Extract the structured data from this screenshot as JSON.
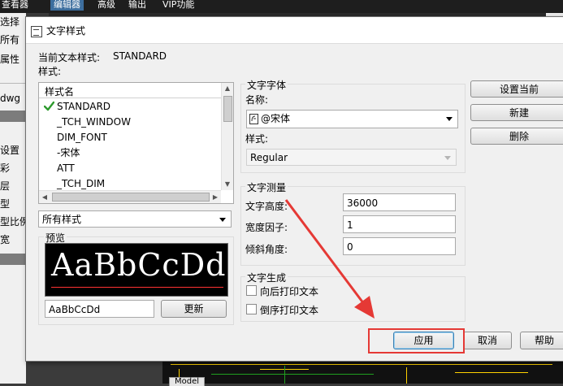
{
  "app": {
    "menu": [
      "查看器",
      "编辑器",
      "高级",
      "输出",
      "VIP功能"
    ],
    "left_panel_rows": [
      "选择",
      "所有",
      "属性",
      "dwg",
      "设置",
      "彩",
      "层",
      "型",
      "型比例",
      "宽"
    ],
    "model_tab": "Model"
  },
  "dialog": {
    "title": "文字样式",
    "current_style_label": "当前文本样式:",
    "current_style_value": "STANDARD",
    "styles_label": "样式:",
    "style_list": {
      "header": "样式名",
      "items": [
        "STANDARD",
        "_TCH_WINDOW",
        "DIM_FONT",
        "-宋体",
        "ATT",
        "_TCH_DIM"
      ],
      "checked_index": 0
    },
    "filter_select": {
      "value": "所有样式"
    },
    "preview": {
      "label": "预览",
      "sample": "AaBbCcDd",
      "input_value": "AaBbCcDd",
      "update_button": "更新"
    },
    "font": {
      "group_label": "文字字体",
      "name_label": "名称:",
      "name_value": "@宋体",
      "style_label": "样式:",
      "style_value": "Regular"
    },
    "measure": {
      "group_label": "文字测量",
      "height_label": "文字高度:",
      "height_value": "36000",
      "width_label": "宽度因子:",
      "width_value": "1",
      "oblique_label": "倾斜角度:",
      "oblique_value": "0"
    },
    "generation": {
      "group_label": "文字生成",
      "backward_label": "向后打印文本",
      "backward_checked": false,
      "upside_down_label": "倒序打印文本",
      "upside_down_checked": false
    },
    "side_buttons": {
      "set_current": "设置当前",
      "new": "新建",
      "delete": "删除"
    },
    "bottom_buttons": {
      "apply": "应用",
      "cancel": "取消",
      "help": "帮助"
    }
  },
  "colors": {
    "highlight": "#e53935",
    "check": "#2e9a2e",
    "preview_bg": "#000000"
  }
}
